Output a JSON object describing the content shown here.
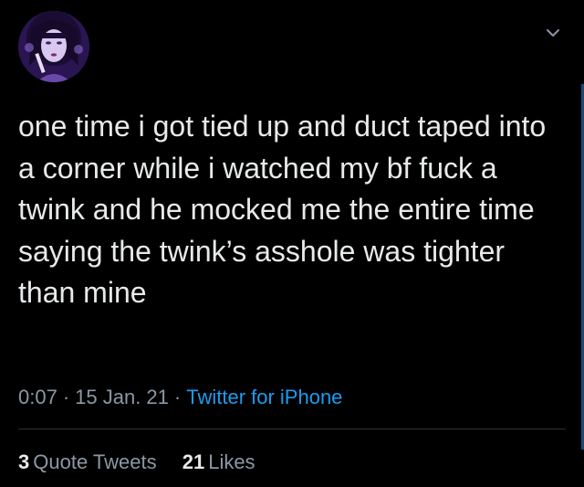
{
  "user": {
    "display_name": "",
    "handle": ""
  },
  "tweet": {
    "text": "one time i got tied up and duct taped into a corner while i watched my bf fuck a twink and he mocked me the entire time saying the twink’s asshole was tighter than mine",
    "time": "0:07",
    "date": "15 Jan. 21",
    "separator": "·",
    "source": "Twitter for iPhone"
  },
  "stats": {
    "quote_tweets_count": "3",
    "quote_tweets_label": "Quote Tweets",
    "likes_count": "21",
    "likes_label": "Likes"
  },
  "icons": {
    "more": "chevron-down-icon"
  },
  "colors": {
    "background": "#000000",
    "text": "#e7e9ea",
    "secondary": "#8b98a5",
    "link": "#1d9bf0"
  }
}
